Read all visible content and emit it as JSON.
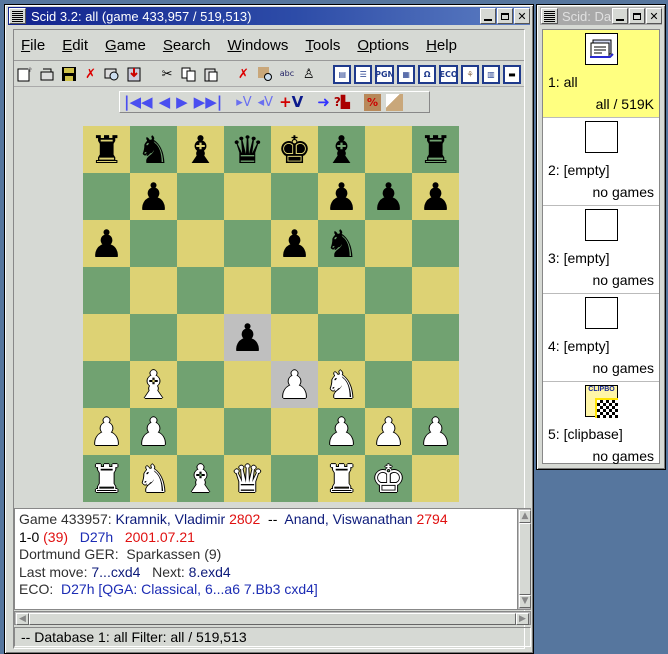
{
  "main_window": {
    "title": "Scid 3.2: all (game 433,957 / 519,513)",
    "menu": [
      {
        "label": "File",
        "ul": "F",
        "rest": "ile"
      },
      {
        "label": "Edit",
        "ul": "E",
        "rest": "dit"
      },
      {
        "label": "Game",
        "ul": "G",
        "rest": "ame"
      },
      {
        "label": "Search",
        "ul": "S",
        "rest": "earch"
      },
      {
        "label": "Windows",
        "ul": "W",
        "rest": "indows"
      },
      {
        "label": "Tools",
        "ul": "T",
        "rest": "ools"
      },
      {
        "label": "Options",
        "ul": "O",
        "rest": "ptions"
      },
      {
        "label": "Help",
        "ul": "H",
        "rest": "elp"
      }
    ],
    "toolbar": {
      "icons": [
        "new-database-icon",
        "open-database-icon",
        "save-icon",
        "close-database-icon",
        "finder-icon",
        "import-icon",
        "cut-icon",
        "copy-icon",
        "paste-icon",
        "reset-search-icon",
        "board-search-icon",
        "header-search-icon",
        "material-search-icon",
        "game-info-icon",
        "game-list-icon",
        "pgn-icon",
        "player-finder-icon",
        "openings-icon",
        "eco-browser-icon",
        "tree-icon",
        "crosstable-icon",
        "engine-icon"
      ],
      "labels": {
        "pgn": "PGN",
        "eco": "ECO"
      }
    },
    "navbar": {
      "start": "|◀◀",
      "back": "◀",
      "forward": "▶",
      "end": "▶▶|",
      "enter_var": "▸V",
      "exit_var": "◂V",
      "add_var_plus": "+",
      "add_var_v": "V"
    },
    "board": {
      "ranks": [
        [
          "r",
          "n",
          "b",
          "q",
          "k",
          "b",
          "",
          "r"
        ],
        [
          "",
          "p",
          "",
          "",
          "",
          "p",
          "p",
          "p"
        ],
        [
          "p",
          "",
          "",
          "",
          "p",
          "n",
          "",
          ""
        ],
        [
          "",
          "",
          "",
          "",
          "",
          "",
          "",
          ""
        ],
        [
          "",
          "",
          "",
          "p",
          "",
          "",
          "",
          ""
        ],
        [
          "",
          "B",
          "",
          "",
          "P",
          "N",
          "",
          ""
        ],
        [
          "P",
          "P",
          "",
          "",
          "",
          "P",
          "P",
          "P"
        ],
        [
          "R",
          "N",
          "B",
          "Q",
          "",
          "R",
          "K",
          ""
        ]
      ],
      "highlight": [
        "d4",
        "e3"
      ]
    },
    "info": {
      "game_label": "Game 433957:",
      "white": "Kramnik, Vladimir",
      "white_elo": "2802",
      "sep": "--",
      "black": "Anand, Viswanathan",
      "black_elo": "2794",
      "result": "1-0",
      "moves": "(39)",
      "eco": "D27h",
      "date": "2001.07.21",
      "site": "Dortmund GER:",
      "event": "Sparkassen (9)",
      "last_move_label": "Last move:",
      "last_move": "7...cxd4",
      "next_label": "Next:",
      "next_move": "8.exd4",
      "eco_label": "ECO:",
      "eco_full": "D27h [QGA: Classical, 6...a6 7.Bb3 cxd4]"
    },
    "status": "--  Database 1: all   Filter: all / 519,513"
  },
  "db_window": {
    "title": "Scid: Da",
    "slots": [
      {
        "name": "1: all",
        "count": "all / 519K",
        "icon": "database-icon",
        "selected": true
      },
      {
        "name": "2: [empty]",
        "count": "no games",
        "icon": "empty-icon"
      },
      {
        "name": "3: [empty]",
        "count": "no games",
        "icon": "empty-icon"
      },
      {
        "name": "4: [empty]",
        "count": "no games",
        "icon": "empty-icon"
      },
      {
        "name": "5: [clipbase]",
        "count": "no games",
        "icon": "clipbase-icon",
        "icon_text": "CLIPBO"
      }
    ]
  },
  "colors": {
    "light_square": "#ddd274",
    "dark_square": "#71a271",
    "highlight": "#bfbfbf",
    "title_active": "#12238e",
    "desktop": "#56769e"
  }
}
